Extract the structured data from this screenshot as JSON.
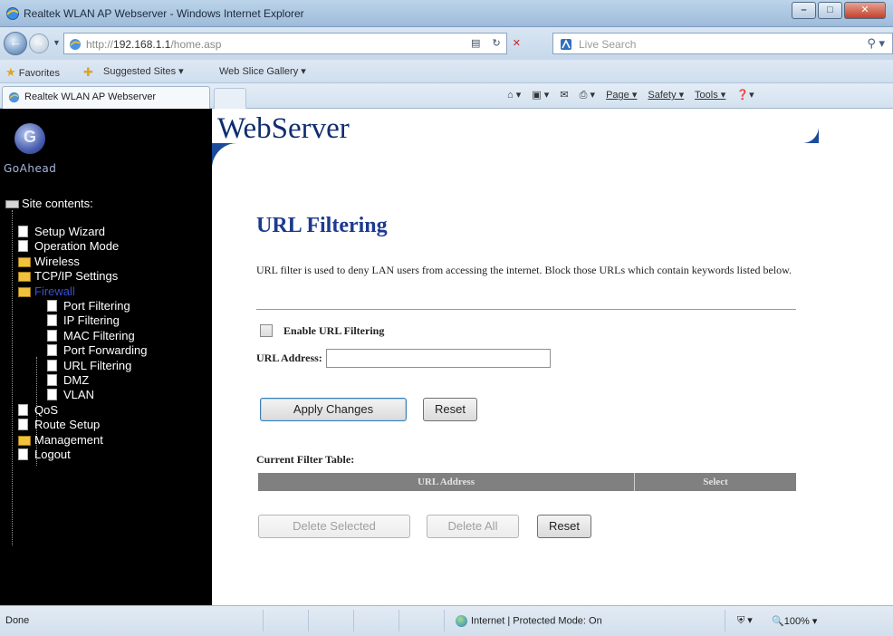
{
  "window": {
    "title": "Realtek WLAN AP Webserver - Windows Internet Explorer",
    "controls": {
      "minimize": "–",
      "maximize": "□",
      "close": "✕"
    }
  },
  "addressbar": {
    "url_prefix": "http://",
    "url_host": "192.168.1.1",
    "url_path": "/home.asp",
    "search_placeholder": "Live Search"
  },
  "favorites_bar": {
    "favorites_label": "Favorites",
    "items": [
      "Suggested Sites ▾",
      "Web Slice Gallery ▾"
    ]
  },
  "tab": {
    "label": "Realtek WLAN AP Webserver"
  },
  "command_bar": {
    "items": [
      "Page ▾",
      "Safety ▾",
      "Tools ▾"
    ]
  },
  "sidebar": {
    "brand": "GoAhead",
    "tree_root": "Site contents:",
    "items": [
      {
        "label": "Setup Wizard",
        "type": "doc",
        "level": 1
      },
      {
        "label": "Operation Mode",
        "type": "doc",
        "level": 1
      },
      {
        "label": "Wireless",
        "type": "folder",
        "level": 1
      },
      {
        "label": "TCP/IP Settings",
        "type": "folder",
        "level": 1
      },
      {
        "label": "Firewall",
        "type": "folder",
        "level": 1,
        "active": true
      },
      {
        "label": "Port Filtering",
        "type": "doc",
        "level": 2
      },
      {
        "label": "IP Filtering",
        "type": "doc",
        "level": 2
      },
      {
        "label": "MAC Filtering",
        "type": "doc",
        "level": 2
      },
      {
        "label": "Port Forwarding",
        "type": "doc",
        "level": 2
      },
      {
        "label": "URL Filtering",
        "type": "doc",
        "level": 2
      },
      {
        "label": "DMZ",
        "type": "doc",
        "level": 2
      },
      {
        "label": "VLAN",
        "type": "doc",
        "level": 2
      },
      {
        "label": "QoS",
        "type": "doc",
        "level": 1
      },
      {
        "label": "Route Setup",
        "type": "doc",
        "level": 1
      },
      {
        "label": "Management",
        "type": "folder",
        "level": 1
      },
      {
        "label": "Logout",
        "type": "doc",
        "level": 1
      }
    ]
  },
  "header": {
    "site_title": "WebServer"
  },
  "main": {
    "title": "URL Filtering",
    "description": "URL filter is used to deny LAN users from accessing the internet. Block those URLs which contain keywords listed below.",
    "enable_label": "Enable URL Filtering",
    "enable_checked": false,
    "url_address_label": "URL Address:",
    "url_address_value": "",
    "apply_button": "Apply Changes",
    "reset_button": "Reset",
    "filter_table_heading": "Current Filter Table:",
    "filter_table_columns": [
      "URL Address",
      "Select"
    ],
    "delete_selected_button": "Delete Selected",
    "delete_all_button": "Delete All",
    "reset_button_2": "Reset"
  },
  "statusbar": {
    "status": "Done",
    "zone": "Internet | Protected Mode: On",
    "zoom": "100%"
  }
}
